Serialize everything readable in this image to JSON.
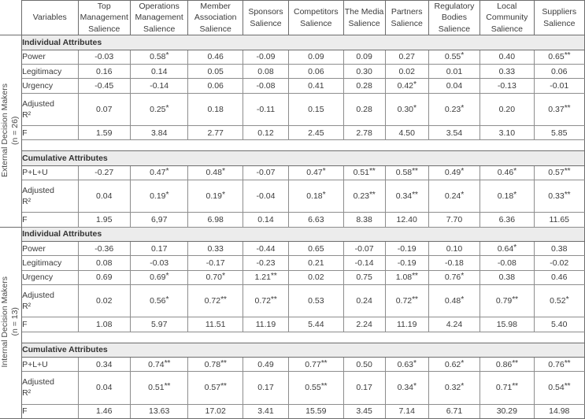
{
  "table": {
    "header": {
      "variables_label": "Variables",
      "columns": [
        "Top Management Salience",
        "Operations Management Salience",
        "Member Association Salience",
        "Sponsors Salience",
        "Competitors Salience",
        "The Media Salience",
        "Partners Salience",
        "Regulatory Bodies Salience",
        "Local Community Salience",
        "Suppliers Salience"
      ]
    },
    "groups": [
      {
        "label": "External Decision Makers",
        "n_label": "(n = 26)",
        "sections": [
          {
            "title": "Individual Attributes",
            "rows": [
              {
                "label": "Power",
                "values": [
                  "-0.03",
                  "0.58*",
                  "0.46",
                  "-0.09",
                  "0.09",
                  "0.09",
                  "0.27",
                  "0.55*",
                  "0.40",
                  "0.65**"
                ]
              },
              {
                "label": "Legitimacy",
                "values": [
                  "0.16",
                  "0.14",
                  "0.05",
                  "0.08",
                  "0.06",
                  "0.30",
                  "0.02",
                  "0.01",
                  "0.33",
                  "0.06"
                ]
              },
              {
                "label": "Urgency",
                "values": [
                  "-0.45",
                  "-0.14",
                  "0.06",
                  "-0.08",
                  "0.41",
                  "0.28",
                  "0.42*",
                  "0.04",
                  "-0.13",
                  "-0.01"
                ]
              },
              {
                "label": "Adjusted R²",
                "label_line1": "Adjusted",
                "label_line2": "R²",
                "values": [
                  "0.07",
                  "0.25*",
                  "0.18",
                  "-0.11",
                  "0.15",
                  "0.28",
                  "0.30*",
                  "0.23*",
                  "0.20",
                  "0.37**"
                ]
              },
              {
                "label": "F",
                "values": [
                  "1.59",
                  "3.84",
                  "2.77",
                  "0.12",
                  "2.45",
                  "2.78",
                  "4.50",
                  "3.54",
                  "3.10",
                  "5.85"
                ]
              }
            ]
          },
          {
            "title": "Cumulative Attributes",
            "rows": [
              {
                "label": "P+L+U",
                "values": [
                  "-0.27",
                  "0.47*",
                  "0.48*",
                  "-0.07",
                  "0.47*",
                  "0.51**",
                  "0.58**",
                  "0.49*",
                  "0.46*",
                  "0.57**"
                ]
              },
              {
                "label": "Adjusted R²",
                "label_line1": "Adjusted",
                "label_line2": "R²",
                "values": [
                  "0.04",
                  "0.19*",
                  "0.19*",
                  "-0.04",
                  "0.18*",
                  "0.23**",
                  "0.34**",
                  "0.24*",
                  "0.18*",
                  "0.33**"
                ]
              },
              {
                "label": "F",
                "values": [
                  "1.95",
                  "6,97",
                  "6.98",
                  "0.14",
                  "6.63",
                  "8.38",
                  "12.40",
                  "7.70",
                  "6.36",
                  "11.65"
                ]
              }
            ]
          }
        ]
      },
      {
        "label": "Internal Decision Makers",
        "n_label": "(n = 13)",
        "sections": [
          {
            "title": "Individual Attributes",
            "rows": [
              {
                "label": "Power",
                "values": [
                  "-0.36",
                  "0.17",
                  "0.33",
                  "-0.44",
                  "0.65",
                  "-0.07",
                  "-0.19",
                  "0.10",
                  "0.64*",
                  "0.38"
                ]
              },
              {
                "label": "Legitimacy",
                "values": [
                  "0.08",
                  "-0.03",
                  "-0.17",
                  "-0.23",
                  "0.21",
                  "-0.14",
                  "-0.19",
                  "-0.18",
                  "-0.08",
                  "-0.02"
                ]
              },
              {
                "label": "Urgency",
                "values": [
                  "0.69",
                  "0.69*",
                  "0.70*",
                  "1.21**",
                  "0.02",
                  "0.75",
                  "1.08**",
                  "0.76*",
                  "0.38",
                  "0.46"
                ]
              },
              {
                "label": "Adjusted R²",
                "label_line1": "Adjusted",
                "label_line2": "R²",
                "values": [
                  "0.02",
                  "0.56*",
                  "0.72**",
                  "0.72**",
                  "0.53",
                  "0.24",
                  "0.72**",
                  "0.48*",
                  "0.79**",
                  "0.52*"
                ]
              },
              {
                "label": "F",
                "values": [
                  "1.08",
                  "5.97",
                  "11.51",
                  "11.19",
                  "5.44",
                  "2.24",
                  "11.19",
                  "4.24",
                  "15.98",
                  "5.40"
                ]
              }
            ]
          },
          {
            "title": "Cumulative Attributes",
            "rows": [
              {
                "label": "P+L+U",
                "values": [
                  "0.34",
                  "0.74**",
                  "0.78**",
                  "0.49",
                  "0.77**",
                  "0.50",
                  "0.63*",
                  "0.62*",
                  "0.86**",
                  "0.76**"
                ]
              },
              {
                "label": "Adjusted R²",
                "label_line1": "Adjusted",
                "label_line2": "R²",
                "values": [
                  "0.04",
                  "0.51**",
                  "0.57**",
                  "0.17",
                  "0.55**",
                  "0.17",
                  "0.34*",
                  "0.32*",
                  "0.71**",
                  "0.54**"
                ]
              },
              {
                "label": "F",
                "values": [
                  "1.46",
                  "13.63",
                  "17.02",
                  "3.41",
                  "15.59",
                  "3.45",
                  "7.14",
                  "6.71",
                  "30.29",
                  "14.98"
                ]
              }
            ]
          }
        ]
      }
    ]
  }
}
